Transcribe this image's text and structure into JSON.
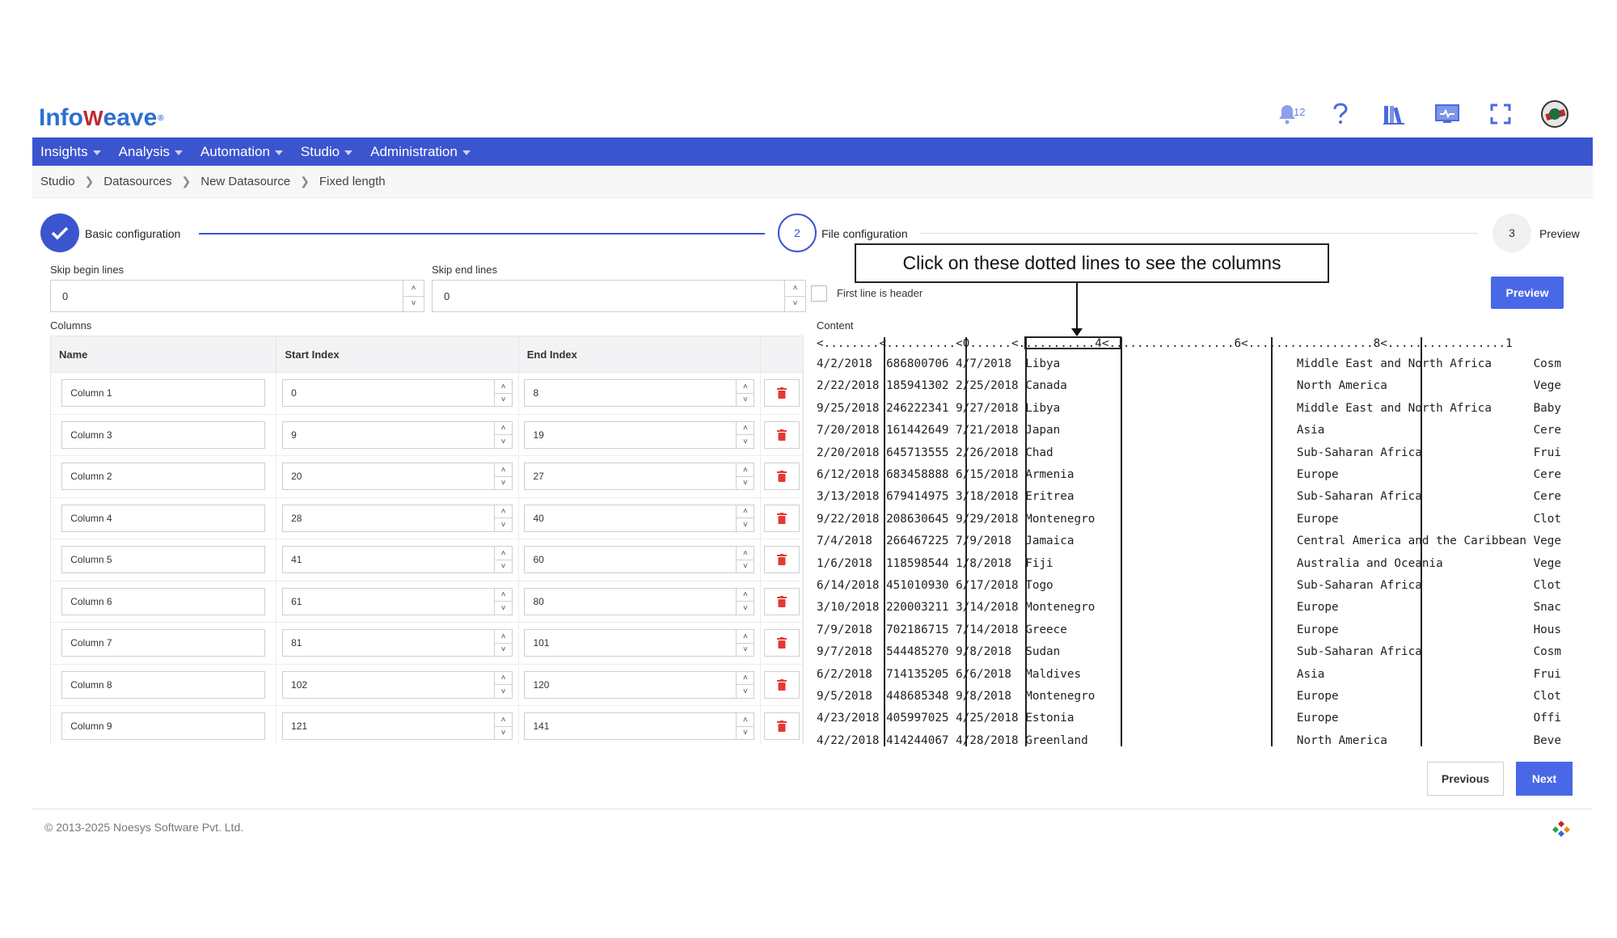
{
  "brand": {
    "logo_a": "Info",
    "logo_b": "W",
    "logo_c": "eave",
    "mark": "®"
  },
  "header": {
    "notification_count": "12"
  },
  "nav": [
    "Insights",
    "Analysis",
    "Automation",
    "Studio",
    "Administration"
  ],
  "breadcrumb": [
    "Studio",
    "Datasources",
    "New Datasource",
    "Fixed length"
  ],
  "steps": [
    {
      "num": "",
      "label": "Basic configuration"
    },
    {
      "num": "2",
      "label": "File configuration"
    },
    {
      "num": "3",
      "label": "Preview"
    }
  ],
  "form": {
    "skip_begin_label": "Skip begin lines",
    "skip_begin_value": "0",
    "skip_end_label": "Skip end lines",
    "skip_end_value": "0",
    "first_line_header_label": "First line is header",
    "preview_label": "Preview"
  },
  "columns": {
    "section_label": "Columns",
    "headers": [
      "Name",
      "Start Index",
      "End Index"
    ],
    "rows": [
      {
        "name": "Column 1",
        "start": "0",
        "end": "8"
      },
      {
        "name": "Column 3",
        "start": "9",
        "end": "19"
      },
      {
        "name": "Column 2",
        "start": "20",
        "end": "27"
      },
      {
        "name": "Column 4",
        "start": "28",
        "end": "40"
      },
      {
        "name": "Column 5",
        "start": "41",
        "end": "60"
      },
      {
        "name": "Column 6",
        "start": "61",
        "end": "80"
      },
      {
        "name": "Column 7",
        "start": "81",
        "end": "101"
      },
      {
        "name": "Column 8",
        "start": "102",
        "end": "120"
      },
      {
        "name": "Column 9",
        "start": "121",
        "end": "141"
      }
    ]
  },
  "content": {
    "label": "Content",
    "ruler": "<........<..........<0......<...........4<..................6<..................8<.................1",
    "rows": [
      "4/2/2018  686800706 4/7/2018  Libya                                  Middle East and North Africa      Cosm",
      "2/22/2018 185941302 2/25/2018 Canada                                 North America                     Vege",
      "9/25/2018 246222341 9/27/2018 Libya                                  Middle East and North Africa      Baby",
      "7/20/2018 161442649 7/21/2018 Japan                                  Asia                              Cere",
      "2/20/2018 645713555 2/26/2018 Chad                                   Sub-Saharan Africa                Frui",
      "6/12/2018 683458888 6/15/2018 Armenia                                Europe                            Cere",
      "3/13/2018 679414975 3/18/2018 Eritrea                                Sub-Saharan Africa                Cere",
      "9/22/2018 208630645 9/29/2018 Montenegro                             Europe                            Clot",
      "7/4/2018  266467225 7/9/2018  Jamaica                                Central America and the Caribbean Vege",
      "1/6/2018  118598544 1/8/2018  Fiji                                   Australia and Oceania             Vege",
      "6/14/2018 451010930 6/17/2018 Togo                                   Sub-Saharan Africa                Clot",
      "3/10/2018 220003211 3/14/2018 Montenegro                             Europe                            Snac",
      "7/9/2018  702186715 7/14/2018 Greece                                 Europe                            Hous",
      "9/7/2018  544485270 9/8/2018  Sudan                                  Sub-Saharan Africa                Cosm",
      "6/2/2018  714135205 6/6/2018  Maldives                               Asia                              Frui",
      "9/5/2018  448685348 9/8/2018  Montenegro                             Europe                            Clot",
      "4/23/2018 405997025 4/25/2018 Estonia                                Europe                            Offi",
      "4/22/2018 414244067 4/28/2018 Greenland                              North America                     Beve"
    ]
  },
  "annotation": {
    "callout_text": "Click on these dotted lines to see the columns"
  },
  "actions": {
    "previous_label": "Previous",
    "next_label": "Next"
  },
  "footer": {
    "copyright": "© 2013-2025 Noesys Software Pvt. Ltd."
  },
  "colors": {
    "primary": "#3b55cf",
    "button": "#4968e8",
    "delete": "#e53935"
  },
  "icons": [
    "bell-icon",
    "help-icon",
    "library-icon",
    "monitor-icon",
    "fullscreen-icon",
    "avatar",
    "check-icon",
    "trash-icon"
  ]
}
